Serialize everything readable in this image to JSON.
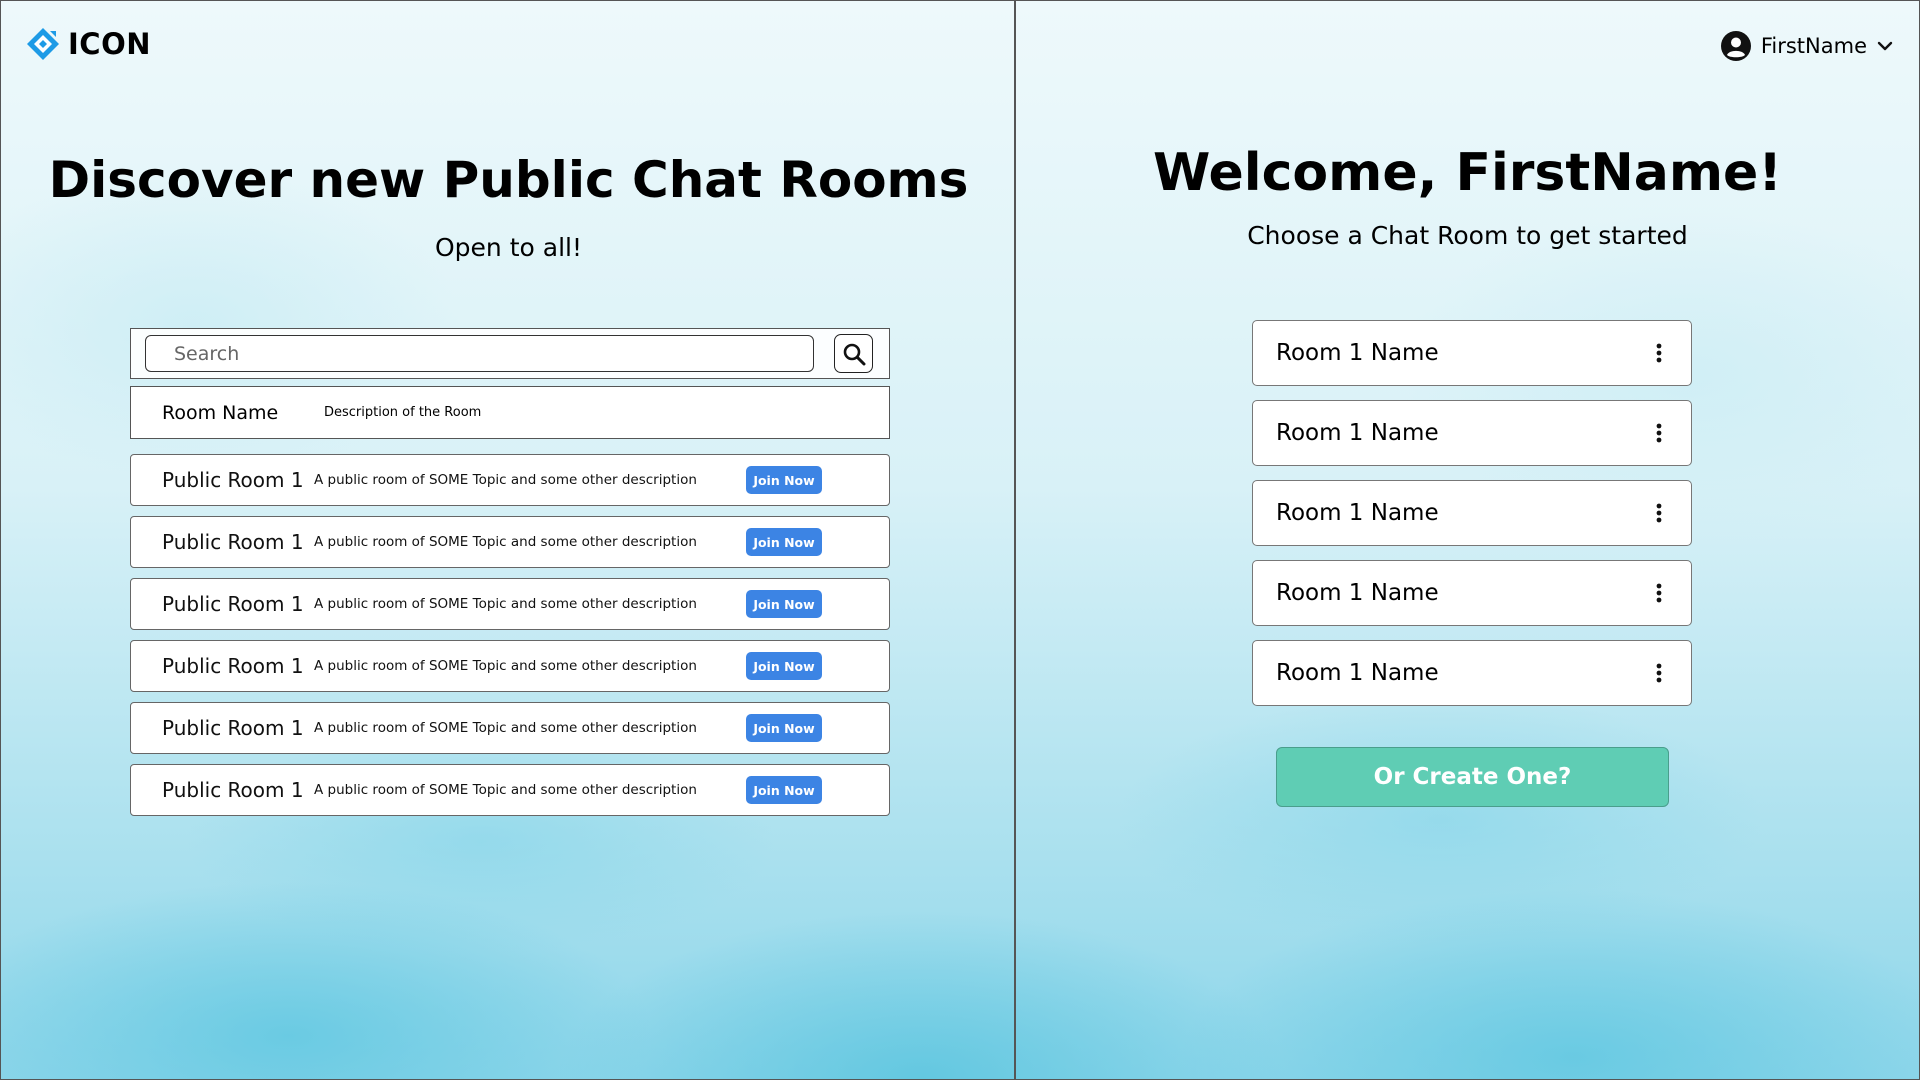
{
  "logo": {
    "text": "ICON",
    "icon": "logo-diamond-icon",
    "color": "#1e9be6"
  },
  "discover": {
    "title": "Discover new Public Chat Rooms",
    "subtitle": "Open to all!",
    "search": {
      "placeholder": "Search",
      "value": "",
      "icon": "search-icon"
    },
    "header": {
      "name": "Room Name",
      "description": "Description of the Room"
    },
    "rooms": [
      {
        "name": "Public Room 1",
        "description": "A public room of SOME Topic and some other description",
        "action": "Join Now"
      },
      {
        "name": "Public Room 1",
        "description": "A public room of SOME Topic and some other description",
        "action": "Join Now"
      },
      {
        "name": "Public Room 1",
        "description": "A public room of SOME Topic and some other description",
        "action": "Join Now"
      },
      {
        "name": "Public Room 1",
        "description": "A public room of SOME Topic and some other description",
        "action": "Join Now"
      },
      {
        "name": "Public Room 1",
        "description": "A public room of SOME Topic and some other description",
        "action": "Join Now"
      },
      {
        "name": "Public Room 1",
        "description": "A public room of SOME Topic and some other description",
        "action": "Join Now"
      }
    ]
  },
  "user": {
    "name": "FirstName",
    "avatar_icon": "user-circle-icon",
    "menu_icon": "chevron-down-icon"
  },
  "welcome": {
    "title": "Welcome, FirstName!",
    "subtitle": "Choose a Chat Room to get started",
    "rooms": [
      {
        "name": "Room 1 Name",
        "menu_icon": "kebab-menu-icon"
      },
      {
        "name": "Room 1 Name",
        "menu_icon": "kebab-menu-icon"
      },
      {
        "name": "Room 1 Name",
        "menu_icon": "kebab-menu-icon"
      },
      {
        "name": "Room 1 Name",
        "menu_icon": "kebab-menu-icon"
      },
      {
        "name": "Room 1 Name",
        "menu_icon": "kebab-menu-icon"
      }
    ],
    "create_label": "Or Create One?"
  },
  "colors": {
    "join_button": "#3c84e4",
    "create_button": "#5fcdb4",
    "background_top": "#eef9fb",
    "background_bottom": "#8ed6ea"
  }
}
